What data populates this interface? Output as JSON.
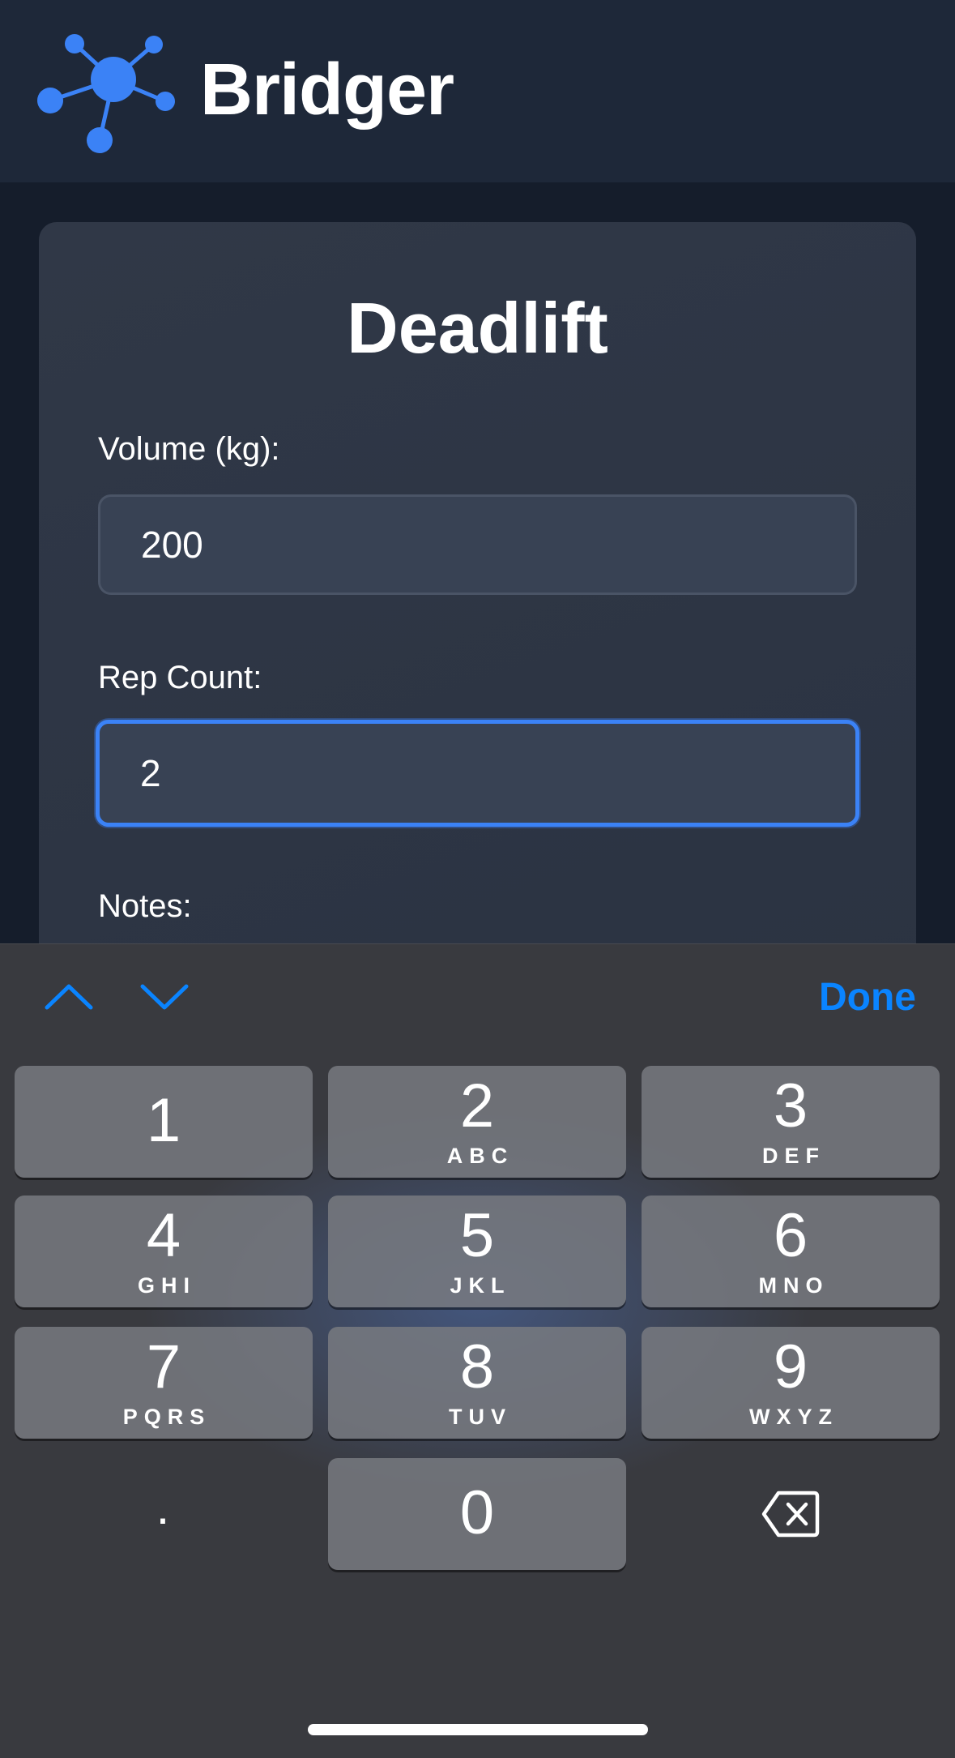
{
  "app": {
    "title": "Bridger"
  },
  "card": {
    "title": "Deadlift",
    "volume_label": "Volume (kg):",
    "volume_value": "200",
    "reps_label": "Rep Count:",
    "reps_value": "2",
    "notes_label": "Notes:"
  },
  "keyboard": {
    "done_label": "Done",
    "prev_icon": "chevron-up-icon",
    "next_icon": "chevron-down-icon",
    "keys": [
      {
        "num": "1",
        "letters": ""
      },
      {
        "num": "2",
        "letters": "ABC"
      },
      {
        "num": "3",
        "letters": "DEF"
      },
      {
        "num": "4",
        "letters": "GHI"
      },
      {
        "num": "5",
        "letters": "JKL"
      },
      {
        "num": "6",
        "letters": "MNO"
      },
      {
        "num": "7",
        "letters": "PQRS"
      },
      {
        "num": "8",
        "letters": "TUV"
      },
      {
        "num": "9",
        "letters": "WXYZ"
      },
      {
        "num": "0",
        "letters": ""
      }
    ],
    "dot_label": ".",
    "backspace_icon": "backspace-icon"
  },
  "colors": {
    "accent": "#3b82f6",
    "done": "#0a84ff",
    "header_bg": "#1e2839",
    "page_bg": "#151d2b",
    "keyboard_bg": "#393a3f"
  }
}
